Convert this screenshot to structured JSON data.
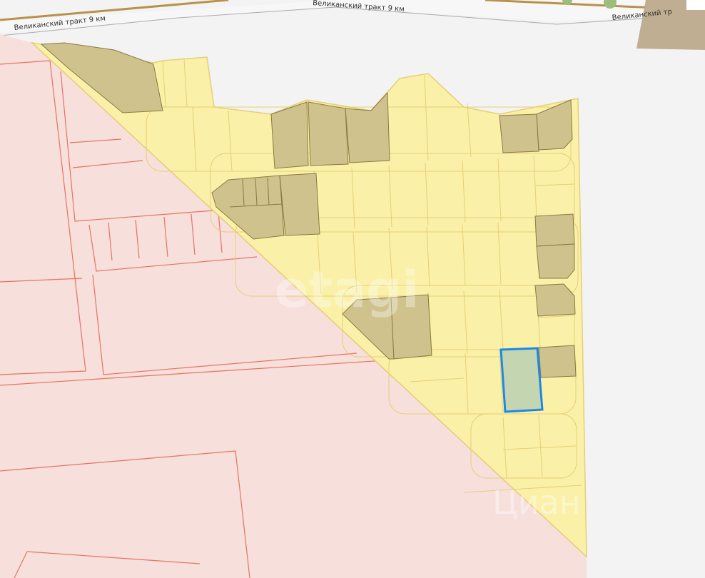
{
  "map": {
    "roads": [
      {
        "name": "Великанский тракт 9 км"
      },
      {
        "name": "Великанский тракт 9 км"
      },
      {
        "name": "Великанский тр"
      }
    ],
    "watermarks": [
      "etagi",
      "Циан"
    ],
    "colors": {
      "background": "#f3f3f3",
      "neighbor_zone": "#f7dfdc",
      "neighbor_border": "#e8735f",
      "settlement_zone": "#faf0a8",
      "parcel_border": "#e6cf76",
      "built_parcel": "#cfc28c",
      "selected_parcel_fill": "#c4d5b2",
      "selected_parcel_border": "#1e88e5"
    },
    "selected_parcel": {
      "highlighted": true
    }
  }
}
